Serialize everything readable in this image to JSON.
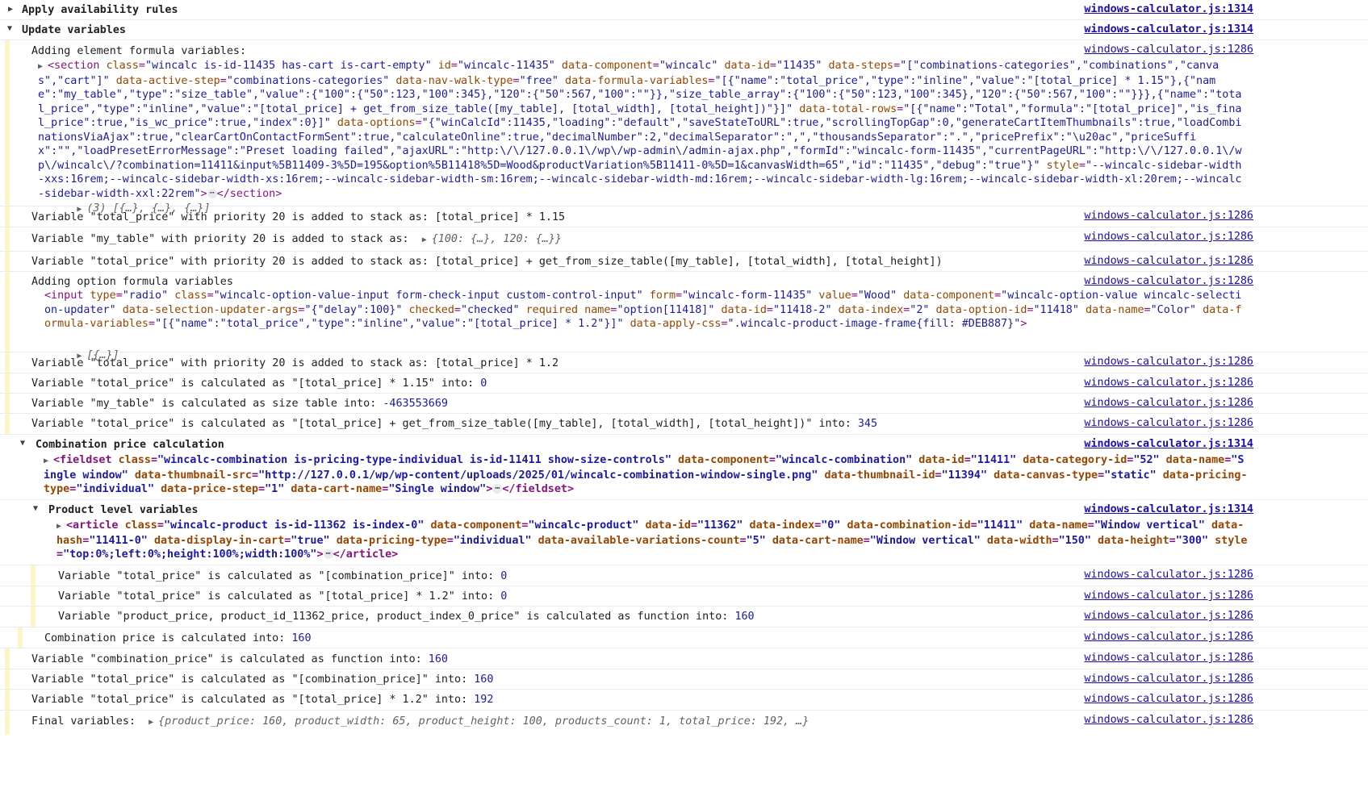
{
  "source_short": "windows-calculator.js:1314",
  "source_log": "windows-calculator.js:1286",
  "group_apply": "Apply availability rules",
  "group_update": "Update variables",
  "adding_element": "Adding element formula variables:",
  "section_html": {
    "open": "<section",
    "attrs": [
      [
        "class",
        "\"wincalc is-id-11435 has-cart is-cart-empty\""
      ],
      [
        "id",
        "\"wincalc-11435\""
      ],
      [
        "data-component",
        "\"wincalc\""
      ],
      [
        "data-id",
        "\"11435\""
      ],
      [
        "data-steps",
        "\"[\"combinations-categories\",\"combinations\",\"canvas\",\"cart\"]\""
      ],
      [
        "data-active-step",
        "\"combinations-categories\""
      ],
      [
        "data-nav-walk-type",
        "\"free\""
      ],
      [
        "data-formula-variables",
        "\"[{\"name\":\"total_price\",\"type\":\"inline\",\"value\":\"[total_price] * 1.15\"},{\"name\":\"my_table\",\"type\":\"size_table\",\"value\":{\"100\":{\"50\":123,\"100\":345},\"120\":{\"50\":567,\"100\":\"\"}},\"size_table_array\":{\"100\":{\"50\":123,\"100\":345},\"120\":{\"50\":567,\"100\":\"\"}}},{\"name\":\"total_price\",\"type\":\"inline\",\"value\":\"[total_price] + get_from_size_table([my_table], [total_width], [total_height])\"}]\""
      ],
      [
        "data-total-rows",
        "\"[{\"name\":\"Total\",\"formula\":\"[total_price]\",\"is_final_price\":true,\"is_wc_price\":true,\"index\":0}]\""
      ],
      [
        "data-options",
        "\"{\"winCalcId\":11435,\"loading\":\"default\",\"saveStateToURL\":true,\"scrollingTopGap\":0,\"generateCartItemThumbnails\":true,\"loadCombinationsViaAjax\":true,\"clearCartOnContactFormSent\":true,\"calculateOnline\":true,\"decimalNumber\":2,\"decimalSeparator\":\",\",\"thousandsSeparator\":\".\",\"pricePrefix\":\"\\u20ac\",\"priceSuffix\":\"\",\"loadPresetErrorMessage\":\"Preset loading failed\",\"ajaxURL\":\"http:\\/\\/127.0.0.1\\/wp\\/wp-admin\\/admin-ajax.php\",\"formId\":\"wincalc-form-11435\",\"currentPageURL\":\"http:\\/\\/127.0.0.1\\/wp\\/wincalc\\/?combination=11411&input%5B11409-3%5D=195&option%5B11418%5D=Wood&productVariation%5B11411-0%5D=1&canvasWidth=65\",\"id\":\"11435\",\"debug\":\"true\"}\""
      ],
      [
        "style",
        "\"--wincalc-sidebar-width-xxs:16rem;--wincalc-sidebar-width-xs:16rem;--wincalc-sidebar-width-sm:16rem;--wincalc-sidebar-width-md:16rem;--wincalc-sidebar-width-lg:16rem;--wincalc-sidebar-width-xl:20rem;--wincalc-sidebar-width-xxl:22rem\""
      ]
    ],
    "close": "</section>"
  },
  "array_preview_3": "(3) [{…}, {…}, {…}]",
  "var_total_115": "Variable \"total_price\" with priority 20 is added to stack as: [total_price] * 1.15",
  "var_my_table": "Variable \"my_table\" with priority 20 is added to stack as: ",
  "my_table_preview": "{100: {…}, 120: {…}}",
  "var_total_sizetable": "Variable \"total_price\" with priority 20 is added to stack as: [total_price] + get_from_size_table([my_table], [total_width], [total_height])",
  "adding_option": "Adding option formula variables",
  "input_html": {
    "open": "<input",
    "attrs": [
      [
        "type",
        "\"radio\""
      ],
      [
        "class",
        "\"wincalc-option-value-input form-check-input custom-control-input\""
      ],
      [
        "form",
        "\"wincalc-form-11435\""
      ],
      [
        "value",
        "\"Wood\""
      ],
      [
        "data-component",
        "\"wincalc-option-value wincalc-selection-updater\""
      ],
      [
        "data-selection-updater-args",
        "\"{\"delay\":100}\""
      ],
      [
        "checked",
        "\"checked\""
      ],
      [
        "required",
        ""
      ],
      [
        "name",
        "\"option[11418]\""
      ],
      [
        "data-id",
        "\"11418-2\""
      ],
      [
        "data-index",
        "\"2\""
      ],
      [
        "data-option-id",
        "\"11418\""
      ],
      [
        "data-name",
        "\"Color\""
      ],
      [
        "data-formula-variables",
        "\"[{\"name\":\"total_price\",\"type\":\"inline\",\"value\":\"[total_price] * 1.2\"}]\""
      ],
      [
        "data-apply-css",
        "\".wincalc-product-image-frame{fill: #DEB887}\""
      ]
    ],
    "close": ">"
  },
  "array_preview_1": "[{…}]",
  "var_total_12": "Variable \"total_price\" with priority 20 is added to stack as: [total_price] * 1.2",
  "calc_total_115": {
    "text": "Variable \"total_price\" is calculated as \"[total_price] * 1.15\" into: ",
    "value": "0"
  },
  "calc_my_table": {
    "text": "Variable \"my_table\" is calculated as size table into: ",
    "value": "-463553669"
  },
  "calc_total_sizetable": {
    "text": "Variable \"total_price\" is calculated as \"[total_price] + get_from_size_table([my_table], [total_width], [total_height])\" into: ",
    "value": "345"
  },
  "group_combination": "Combination price calculation",
  "fieldset_html": {
    "open": "<fieldset",
    "attrs": [
      [
        "class",
        "\"wincalc-combination is-pricing-type-individual is-id-11411 show-size-controls\""
      ],
      [
        "data-component",
        "\"wincalc-combination\""
      ],
      [
        "data-id",
        "\"11411\""
      ],
      [
        "data-category-id",
        "\"52\""
      ],
      [
        "data-name",
        "\"Single window\""
      ],
      [
        "data-thumbnail-src",
        "\"http://127.0.0.1/wp/wp-content/uploads/2025/01/wincalc-combination-window-single.png\""
      ],
      [
        "data-thumbnail-id",
        "\"11394\""
      ],
      [
        "data-canvas-type",
        "\"static\""
      ],
      [
        "data-pricing-type",
        "\"individual\""
      ],
      [
        "data-price-step",
        "\"1\""
      ],
      [
        "data-cart-name",
        "\"Single window\""
      ]
    ],
    "close": "</fieldset>"
  },
  "group_product": "Product level variables",
  "article_html": {
    "open": "<article",
    "attrs": [
      [
        "class",
        "\"wincalc-product is-id-11362 is-index-0\""
      ],
      [
        "data-component",
        "\"wincalc-product\""
      ],
      [
        "data-id",
        "\"11362\""
      ],
      [
        "data-index",
        "\"0\""
      ],
      [
        "data-combination-id",
        "\"11411\""
      ],
      [
        "data-name",
        "\"Window vertical\""
      ],
      [
        "data-hash",
        "\"11411-0\""
      ],
      [
        "data-display-in-cart",
        "\"true\""
      ],
      [
        "data-pricing-type",
        "\"individual\""
      ],
      [
        "data-available-variations-count",
        "\"5\""
      ],
      [
        "data-cart-name",
        "\"Window vertical\""
      ],
      [
        "data-width",
        "\"150\""
      ],
      [
        "data-height",
        "\"300\""
      ],
      [
        "style",
        "\"top:0%;left:0%;height:100%;width:100%\""
      ]
    ],
    "close": "</article>"
  },
  "calc_prod_combination": {
    "text": "Variable \"total_price\" is calculated as \"[combination_price]\" into: ",
    "value": "0"
  },
  "calc_prod_12": {
    "text": "Variable \"total_price\" is calculated as \"[total_price] * 1.2\" into: ",
    "value": "0"
  },
  "calc_prod_function": {
    "text": "Variable \"product_price, product_id_11362_price, product_index_0_price\" is calculated as function into: ",
    "value": "160"
  },
  "calc_combination_price": {
    "text": "Combination price is calculated into: ",
    "value": "160"
  },
  "calc_combination_var": {
    "text": "Variable \"combination_price\" is calculated as function into: ",
    "value": "160"
  },
  "calc_total_combination": {
    "text": "Variable \"total_price\" is calculated as \"[combination_price]\" into: ",
    "value": "160"
  },
  "calc_total_final": {
    "text": "Variable \"total_price\" is calculated as \"[total_price] * 1.2\" into: ",
    "value": "192"
  },
  "final_label": "Final variables: ",
  "final_preview": "{product_price: 160, product_width: 65, product_height: 100, products_count: 1, total_price: 192, …}",
  "icons": {
    "expand": "triangle-right",
    "collapse": "triangle-down"
  },
  "colors": {
    "tag": "#881280",
    "attr": "#994500",
    "value": "#1a1aa6",
    "link": "#1a0dab",
    "group_bar": "#fdf4c7"
  }
}
